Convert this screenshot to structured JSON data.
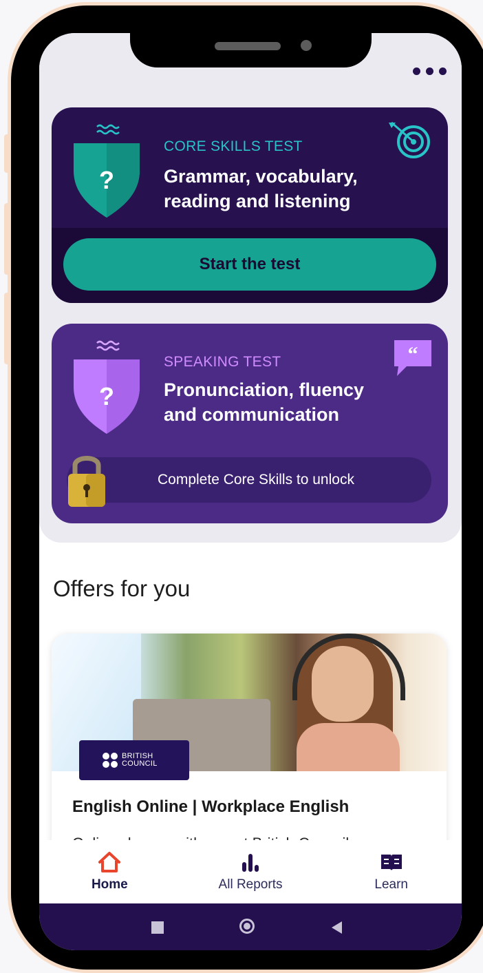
{
  "header": {
    "more_icon": "more-horizontal-icon"
  },
  "core_test": {
    "kicker": "CORE SKILLS TEST",
    "headline": "Grammar, vocabulary, reading and listening",
    "shield_glyph": "?",
    "button_label": "Start the test",
    "colors": {
      "card": "#27114f",
      "accent": "#16a392",
      "kicker": "#29c4c8"
    }
  },
  "speaking_test": {
    "kicker": "SPEAKING TEST",
    "headline": "Pronunciation, fluency and communication",
    "shield_glyph": "?",
    "lock_message": "Complete Core Skills to unlock",
    "quote_glyph": "“",
    "colors": {
      "card": "#4b2b86",
      "accent": "#b86cff",
      "lock": "#d9b23a"
    }
  },
  "offers": {
    "section_title": "Offers for you",
    "items": [
      {
        "brand_line1": "BRITISH",
        "brand_line2": "COUNCIL",
        "title": "English Online | Workplace English",
        "description": "Online classes with expert British Council"
      }
    ]
  },
  "bottom_nav": {
    "items": [
      {
        "label": "Home",
        "icon": "home-icon",
        "active": true
      },
      {
        "label": "All Reports",
        "icon": "bar-chart-icon",
        "active": false
      },
      {
        "label": "Learn",
        "icon": "book-icon",
        "active": false
      }
    ],
    "active_color": "#e8452c"
  },
  "system_nav": {
    "icons": [
      "recents-icon",
      "home-circle-icon",
      "back-icon"
    ]
  }
}
